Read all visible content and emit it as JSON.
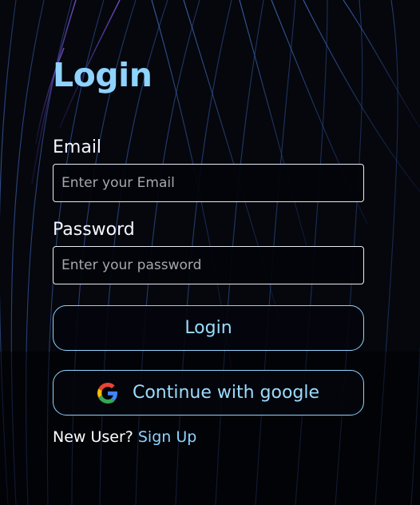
{
  "colors": {
    "background": "#05070d",
    "accent": "#8fd3ff",
    "input_border": "#e7ecf5",
    "placeholder": "#a7a7ab"
  },
  "login_form": {
    "title": "Login",
    "email": {
      "label": "Email",
      "placeholder": "Enter your Email",
      "value": ""
    },
    "password": {
      "label": "Password",
      "placeholder": "Enter your password",
      "value": ""
    },
    "login_button_label": "Login",
    "google_button": {
      "label": "Continue with google",
      "icon": "google-icon"
    },
    "signup": {
      "prompt": "New User?",
      "link_label": "Sign Up"
    }
  }
}
